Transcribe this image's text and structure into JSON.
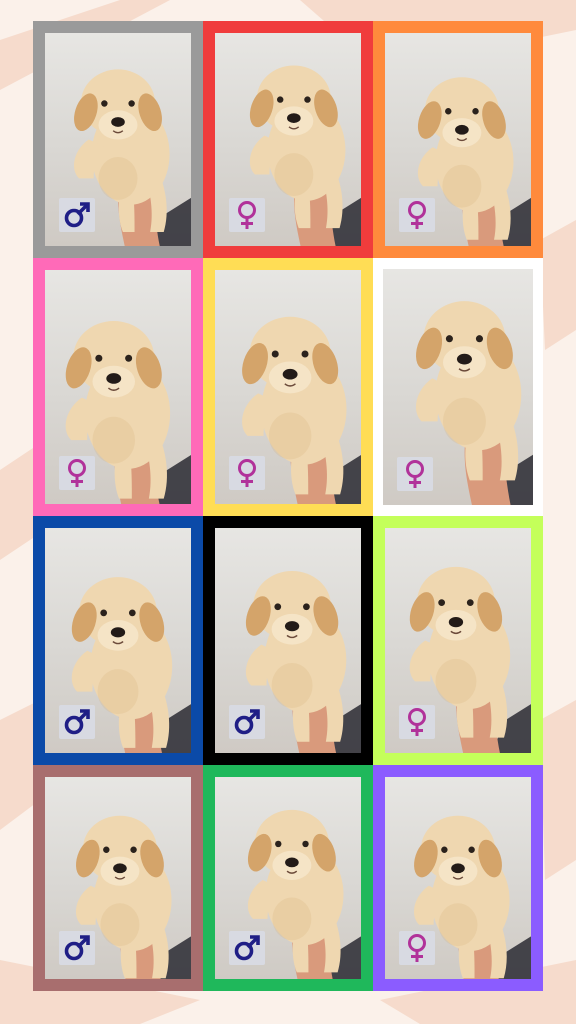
{
  "background": {
    "base": "#fbf1ea",
    "streaks": "#f2c9b2"
  },
  "colors": {
    "fur": "#efd7b0",
    "fur_shade": "#d9b27c",
    "ear": "#d4a46a",
    "hand": "#d99a7c",
    "male_symbol": "#1f1e86",
    "female_symbol": "#b1329a",
    "badge": "#d8dae2"
  },
  "puppies": [
    {
      "frame_color": "#9a9a9a",
      "gender": "male",
      "symbol": "♂"
    },
    {
      "frame_color": "#f03c3c",
      "gender": "female",
      "symbol": "♀"
    },
    {
      "frame_color": "#ff8a3c",
      "gender": "female",
      "symbol": "♀"
    },
    {
      "frame_color": "#ff6ab8",
      "gender": "female",
      "symbol": "♀"
    },
    {
      "frame_color": "#ffdd55",
      "gender": "female",
      "symbol": "♀"
    },
    {
      "frame_color": "#ffffff",
      "gender": "female",
      "symbol": "♀"
    },
    {
      "frame_color": "#0b4aa8",
      "gender": "male",
      "symbol": "♂"
    },
    {
      "frame_color": "#000000",
      "gender": "male",
      "symbol": "♂"
    },
    {
      "frame_color": "#c4ff5a",
      "gender": "female",
      "symbol": "♀"
    },
    {
      "frame_color": "#a86e6e",
      "gender": "male",
      "symbol": "♂"
    },
    {
      "frame_color": "#1fb85b",
      "gender": "male",
      "symbol": "♂"
    },
    {
      "frame_color": "#8b5cff",
      "gender": "female",
      "symbol": "♀"
    }
  ]
}
